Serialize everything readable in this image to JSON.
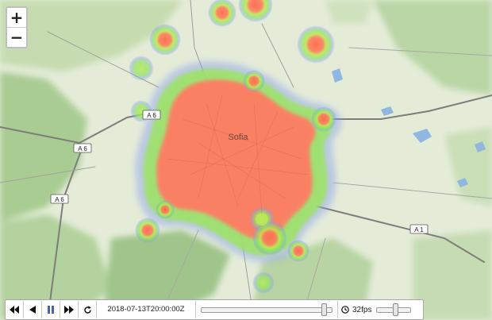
{
  "map": {
    "city_label": "Sofia",
    "road_labels": [
      {
        "text": "A 6",
        "id": "a6-north"
      },
      {
        "text": "A 6",
        "id": "a6-west"
      },
      {
        "text": "A 6",
        "id": "a6-south"
      },
      {
        "text": "A 1",
        "id": "a1-east"
      }
    ],
    "colors": {
      "land": "#e4ecd8",
      "hills": "#bdd6a6",
      "forest": "#a6c991",
      "water": "#8fb7df",
      "road": "#7a7a7a",
      "heat_core": "#ff7f63",
      "heat_mid": "#9fe35a",
      "heat_edge": "#8fa0e8"
    }
  },
  "zoom": {
    "in_label": "+",
    "out_label": "−"
  },
  "player": {
    "timestamp": "2018-07-13T20:00:00Z",
    "timeline_progress": 0.95,
    "fps_label": "32fps",
    "fps_level": 0.55,
    "icons": {
      "first": "skip-back-icon",
      "back": "step-back-icon",
      "pause": "pause-icon",
      "forward": "fast-forward-icon",
      "reload": "reload-icon",
      "clock": "clock-icon"
    }
  }
}
